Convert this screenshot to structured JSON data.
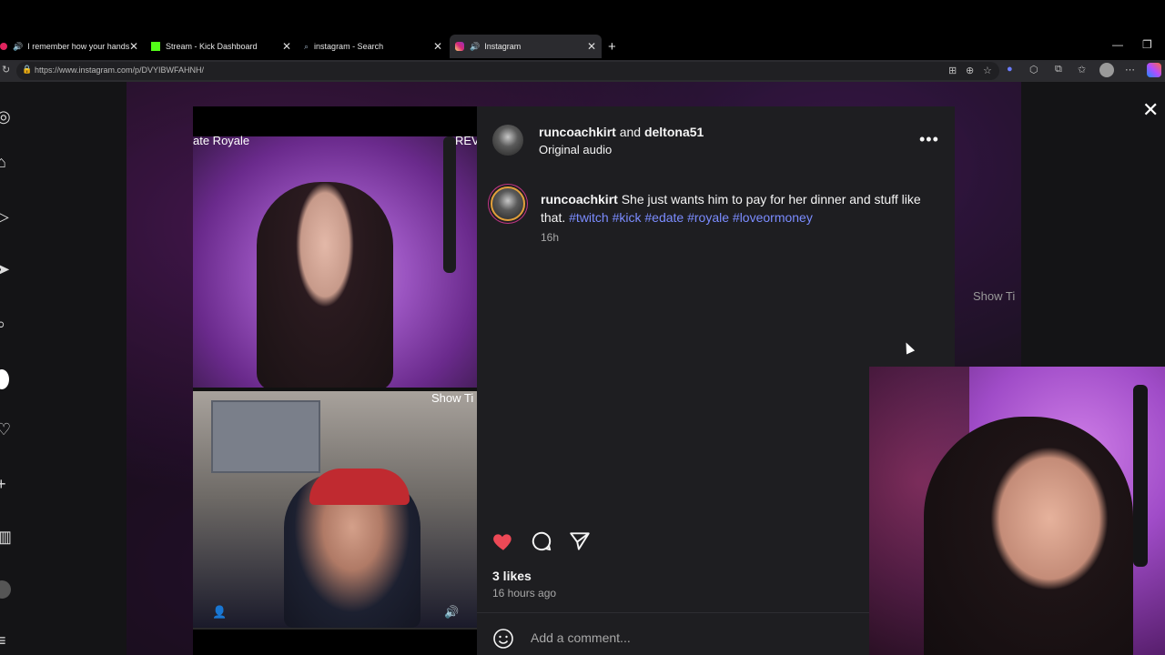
{
  "tabs": [
    {
      "title": "I remember how your hands",
      "active": false
    },
    {
      "title": "Stream - Kick Dashboard",
      "active": false
    },
    {
      "title": "instagram - Search",
      "active": false
    },
    {
      "title": "Instagram",
      "active": true
    }
  ],
  "address_bar": {
    "url": "https://www.instagram.com/p/DVYIBWFAHNH/"
  },
  "colors": {
    "accent_like": "#ed4956",
    "hashtag": "#7b8cff",
    "panel_bg": "#1e1e21"
  },
  "video": {
    "top_label": "ate Royale",
    "top_right_label": "REV",
    "bottom_right_label": "Show Ti",
    "background_label": "Show Ti"
  },
  "post": {
    "author": "runcoachkirt",
    "conjunction": "and",
    "collaborator": "deltona51",
    "audio": "Original audio",
    "caption_author": "runcoachkirt",
    "caption_text": "She just wants him to pay for her dinner and stuff like that.",
    "hashtags": "#twitch #kick #edate #royale #loveormoney",
    "caption_time": "16h",
    "likes": "3 likes",
    "time_ago": "16 hours ago",
    "comment_placeholder": "Add a comment..."
  }
}
